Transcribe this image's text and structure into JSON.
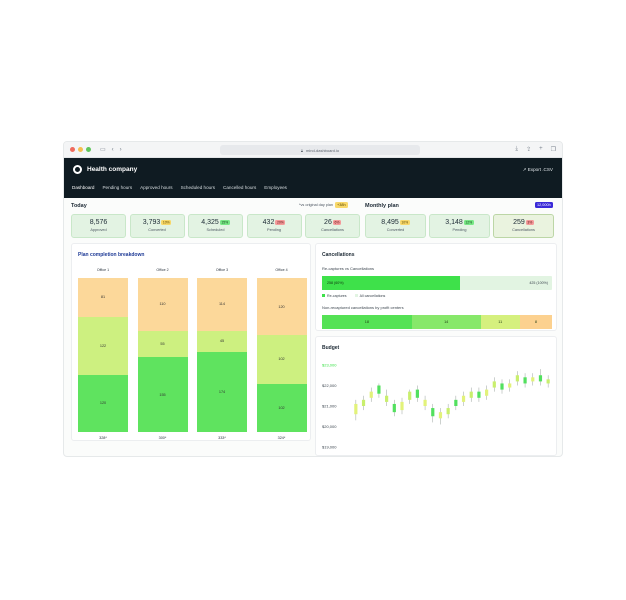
{
  "browser": {
    "url": "mind-dashboard.io"
  },
  "header": {
    "brand": "Health company",
    "export_label": "Export .CSV",
    "nav": [
      "Dashboard",
      "Pending hours",
      "Approved hours",
      "Scheduled hours",
      "Cancelled hours",
      "Employees"
    ]
  },
  "today": {
    "title": "Today",
    "compare_label": "*vs original day plan",
    "compare_badge": "+38h",
    "kpis": [
      {
        "value": "8,576",
        "label": "Approved",
        "badge": ""
      },
      {
        "value": "3,793",
        "label": "Converted",
        "badge": "10%",
        "badge_type": "y"
      },
      {
        "value": "4,325",
        "label": "Scheduled",
        "badge": "15%",
        "badge_type": "g"
      },
      {
        "value": "432",
        "label": "Pending",
        "badge": "20%",
        "badge_type": "r"
      },
      {
        "value": "26",
        "label": "Cancellations",
        "badge": "6%",
        "badge_type": "r"
      }
    ]
  },
  "monthly": {
    "title": "Monthly plan",
    "badge": "12,000h",
    "kpis": [
      {
        "value": "8,495",
        "label": "Converted",
        "badge": "10%",
        "badge_type": "y"
      },
      {
        "value": "3,148",
        "label": "Pending",
        "badge": "12%",
        "badge_type": "g"
      },
      {
        "value": "259",
        "label": "Cancellations",
        "badge": "3%",
        "badge_type": "r"
      }
    ]
  },
  "plan": {
    "title": "Plan completion breakdown",
    "offices": [
      {
        "name": "Office 1",
        "total": "328*",
        "segments": [
          {
            "v": 120,
            "c": "#5fe35f"
          },
          {
            "v": 122,
            "c": "#cdf080"
          },
          {
            "v": 81,
            "c": "#fcd89a"
          }
        ]
      },
      {
        "name": "Office 2",
        "total": "300*",
        "segments": [
          {
            "v": 155,
            "c": "#5fe35f"
          },
          {
            "v": 55,
            "c": "#cdf080"
          },
          {
            "v": 110,
            "c": "#fcd89a"
          }
        ]
      },
      {
        "name": "Office 3",
        "total": "333*",
        "segments": [
          {
            "v": 174,
            "c": "#5fe35f"
          },
          {
            "v": 45,
            "c": "#cdf080"
          },
          {
            "v": 114,
            "c": "#fcd89a"
          }
        ]
      },
      {
        "name": "Office 4",
        "total": "324*",
        "segments": [
          {
            "v": 102,
            "c": "#5fe35f"
          },
          {
            "v": 102,
            "c": "#cdf080"
          },
          {
            "v": 120,
            "c": "#fcd89a"
          }
        ]
      }
    ]
  },
  "cancellations": {
    "title": "Cancellations",
    "subtitle": "Re-captures vs Cancellations",
    "bar_left": "258 (60%)",
    "bar_right": "425 (100%)",
    "bar_fill_fraction": 0.6,
    "legend": [
      "Re-captures",
      "All cancellations"
    ],
    "profit_title": "Non-recaptured cancellations by profit centers",
    "profit": [
      {
        "v": "18",
        "c": "#55e255"
      },
      {
        "v": "14",
        "c": "#87e86a"
      },
      {
        "v": "11",
        "c": "#d5f07e"
      },
      {
        "v": "8",
        "c": "#fcd18f"
      }
    ],
    "profit_fractions": [
      0.39,
      0.3,
      0.17,
      0.14
    ]
  },
  "budget": {
    "title": "Budget",
    "y_labels": [
      "$23,000",
      "$22,000",
      "$21,000",
      "$20,000",
      "$19,000"
    ]
  },
  "chart_data": {
    "type": "candlestick",
    "title": "Budget",
    "ylim": [
      19000,
      23000
    ],
    "candles": [
      {
        "o": 20600,
        "c": 21100,
        "h": 21300,
        "l": 20300,
        "col": "#e2f27a"
      },
      {
        "o": 21000,
        "c": 21300,
        "h": 21500,
        "l": 20800,
        "col": "#c9ef6d"
      },
      {
        "o": 21400,
        "c": 21700,
        "h": 21900,
        "l": 21200,
        "col": "#e2f27a"
      },
      {
        "o": 21600,
        "c": 22000,
        "h": 22100,
        "l": 21400,
        "col": "#52e05e"
      },
      {
        "o": 21500,
        "c": 21200,
        "h": 21800,
        "l": 21000,
        "col": "#c9ef6d"
      },
      {
        "o": 21100,
        "c": 20700,
        "h": 21300,
        "l": 20500,
        "col": "#52e05e"
      },
      {
        "o": 20800,
        "c": 21200,
        "h": 21400,
        "l": 20600,
        "col": "#e2f27a"
      },
      {
        "o": 21300,
        "c": 21700,
        "h": 21800,
        "l": 21100,
        "col": "#c9ef6d"
      },
      {
        "o": 21800,
        "c": 21400,
        "h": 22000,
        "l": 21200,
        "col": "#52e05e"
      },
      {
        "o": 21300,
        "c": 21000,
        "h": 21500,
        "l": 20800,
        "col": "#e2f27a"
      },
      {
        "o": 20900,
        "c": 20500,
        "h": 21100,
        "l": 20200,
        "col": "#52e05e"
      },
      {
        "o": 20400,
        "c": 20700,
        "h": 20900,
        "l": 20100,
        "col": "#e2f27a"
      },
      {
        "o": 20600,
        "c": 20900,
        "h": 21100,
        "l": 20400,
        "col": "#c9ef6d"
      },
      {
        "o": 21000,
        "c": 21300,
        "h": 21500,
        "l": 20800,
        "col": "#52e05e"
      },
      {
        "o": 21200,
        "c": 21500,
        "h": 21700,
        "l": 21000,
        "col": "#e2f27a"
      },
      {
        "o": 21400,
        "c": 21700,
        "h": 21900,
        "l": 21200,
        "col": "#c9ef6d"
      },
      {
        "o": 21700,
        "c": 21400,
        "h": 21900,
        "l": 21200,
        "col": "#52e05e"
      },
      {
        "o": 21500,
        "c": 21800,
        "h": 22000,
        "l": 21300,
        "col": "#e2f27a"
      },
      {
        "o": 21900,
        "c": 22200,
        "h": 22400,
        "l": 21700,
        "col": "#c9ef6d"
      },
      {
        "o": 22100,
        "c": 21800,
        "h": 22300,
        "l": 21600,
        "col": "#52e05e"
      },
      {
        "o": 21900,
        "c": 22100,
        "h": 22300,
        "l": 21700,
        "col": "#e2f27a"
      },
      {
        "o": 22200,
        "c": 22500,
        "h": 22700,
        "l": 22000,
        "col": "#c9ef6d"
      },
      {
        "o": 22400,
        "c": 22100,
        "h": 22600,
        "l": 21900,
        "col": "#52e05e"
      },
      {
        "o": 22200,
        "c": 22400,
        "h": 22600,
        "l": 22000,
        "col": "#e2f27a"
      },
      {
        "o": 22500,
        "c": 22200,
        "h": 22800,
        "l": 22000,
        "col": "#52e05e"
      },
      {
        "o": 22100,
        "c": 22300,
        "h": 22500,
        "l": 21900,
        "col": "#c9ef6d"
      }
    ]
  }
}
